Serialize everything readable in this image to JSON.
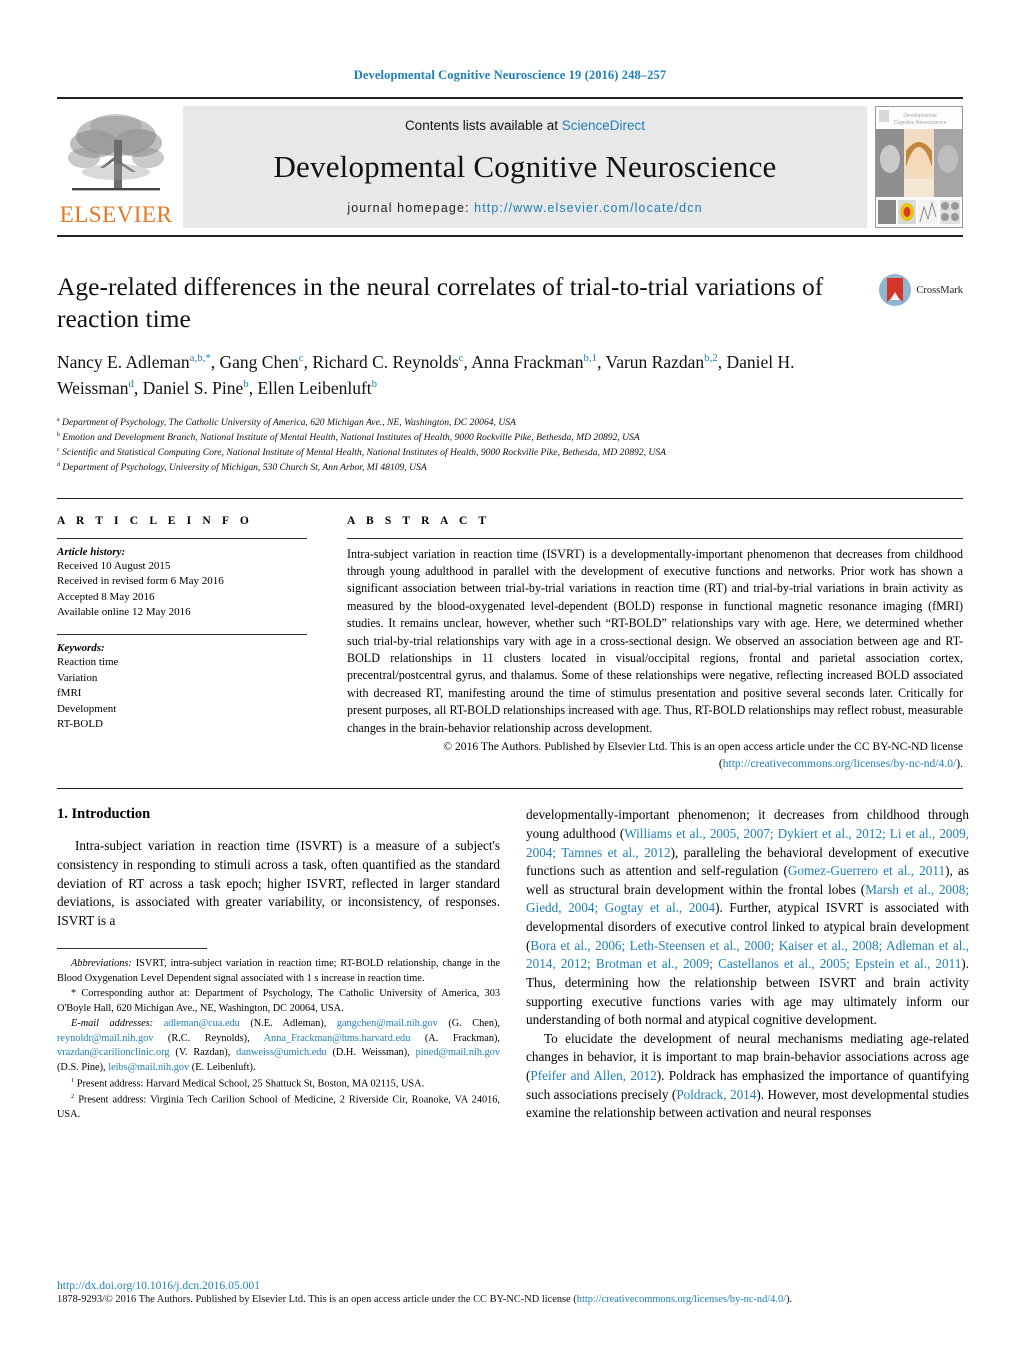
{
  "running_head": "Developmental Cognitive Neuroscience 19 (2016) 248–257",
  "banner": {
    "contents_prefix": "Contents lists available at ",
    "contents_link": "ScienceDirect",
    "journal_name": "Developmental Cognitive Neuroscience",
    "homepage_prefix": "journal homepage: ",
    "homepage_url": "http://www.elsevier.com/locate/dcn",
    "publisher_word": "ELSEVIER",
    "cover_title_line1": "Developmental",
    "cover_title_line2": "Cognitive Neuroscience"
  },
  "title": "Age-related differences in the neural correlates of trial-to-trial variations of reaction time",
  "crossmark_label": "CrossMark",
  "authors_html": "Nancy E. Adleman<sup>a,b,</sup><sup>*</sup>, Gang Chen<sup>c</sup>, Richard C. Reynolds<sup>c</sup>, Anna Frackman<sup>b,1</sup>, Varun Razdan<sup>b,2</sup>, Daniel H. Weissman<sup>d</sup>, Daniel S. Pine<sup>b</sup>, Ellen Leibenluft<sup>b</sup>",
  "affiliations": [
    {
      "marker": "a",
      "text": "Department of Psychology, The Catholic University of America, 620 Michigan Ave., NE, Washington, DC 20064, USA"
    },
    {
      "marker": "b",
      "text": "Emotion and Development Branch, National Institute of Mental Health, National Institutes of Health, 9000 Rockville Pike, Bethesda, MD 20892, USA"
    },
    {
      "marker": "c",
      "text": "Scientific and Statistical Computing Core, National Institute of Mental Health, National Institutes of Health, 9000 Rockville Pike, Bethesda, MD 20892, USA"
    },
    {
      "marker": "d",
      "text": "Department of Psychology, University of Michigan, 530 Church St, Ann Arbor, MI 48109, USA"
    }
  ],
  "article_info": {
    "heading": "A R T I C L E   I N F O",
    "history_label": "Article history:",
    "history": [
      "Received 10 August 2015",
      "Received in revised form 6 May 2016",
      "Accepted 8 May 2016",
      "Available online 12 May 2016"
    ],
    "keywords_label": "Keywords:",
    "keywords": [
      "Reaction time",
      "Variation",
      "fMRI",
      "Development",
      "RT-BOLD"
    ]
  },
  "abstract": {
    "heading": "A B S T R A C T",
    "body": "Intra-subject variation in reaction time (ISVRT) is a developmentally-important phenomenon that decreases from childhood through young adulthood in parallel with the development of executive functions and networks. Prior work has shown a significant association between trial-by-trial variations in reaction time (RT) and trial-by-trial variations in brain activity as measured by the blood-oxygenated level-dependent (BOLD) response in functional magnetic resonance imaging (fMRI) studies. It remains unclear, however, whether such “RT-BOLD” relationships vary with age. Here, we determined whether such trial-by-trial relationships vary with age in a cross-sectional design. We observed an association between age and RT-BOLD relationships in 11 clusters located in visual/occipital regions, frontal and parietal association cortex, precentral/postcentral gyrus, and thalamus. Some of these relationships were negative, reflecting increased BOLD associated with decreased RT, manifesting around the time of stimulus presentation and positive several seconds later. Critically for present purposes, all RT-BOLD relationships increased with age. Thus, RT-BOLD relationships may reflect robust, measurable changes in the brain-behavior relationship across development.",
    "copyright_text": "© 2016 The Authors. Published by Elsevier Ltd. This is an open access article under the CC BY-NC-ND license (",
    "copyright_link": "http://creativecommons.org/licenses/by-nc-nd/4.0/",
    "copyright_tail": ")."
  },
  "body_left": {
    "section_number_title": "1.  Introduction",
    "paragraph_1": "Intra-subject variation in reaction time (ISVRT) is a measure of a subject's consistency in responding to stimuli across a task, often quantified as the standard deviation of RT across a task epoch; higher ISVRT, reflected in larger standard deviations, is associated with greater variability, or inconsistency, of responses. ISVRT is a",
    "footnotes": {
      "abbrev_label": "Abbreviations:",
      "abbrev_text": " ISVRT, intra-subject variation in reaction time; RT-BOLD relationship, change in the Blood Oxygenation Level Dependent signal associated with 1 s increase in reaction time.",
      "corresponding_marker": "*",
      "corresponding_text": " Corresponding author at: Department of Psychology, The Catholic University of America, 303 O'Boyle Hall, 620 Michigan Ave., NE, Washington, DC 20064, USA.",
      "email_label": "E-mail addresses:",
      "emails": [
        {
          "addr": "adleman@cua.edu",
          "who": " (N.E. Adleman),"
        },
        {
          "addr": "gangchen@mail.nih.gov",
          "who": " (G. Chen),"
        },
        {
          "addr": "reynoldr@mail.nih.gov",
          "who": " (R.C. Reynolds),"
        },
        {
          "addr": "Anna_Frackman@hms.harvard.edu",
          "who": " (A. Frackman),"
        },
        {
          "addr": "vrazdan@carilionclinic.org",
          "who": " (V. Razdan),"
        },
        {
          "addr": "danweiss@umich.edu",
          "who": " (D.H. Weissman),"
        },
        {
          "addr": "pined@mail.nih.gov",
          "who": " (D.S. Pine),"
        },
        {
          "addr": "leibs@mail.nih.gov",
          "who": " (E. Leibenluft)."
        }
      ],
      "present_1_marker": "1",
      "present_1_text": " Present address: Harvard Medical School, 25 Shattuck St, Boston, MA 02115, USA.",
      "present_2_marker": "2",
      "present_2_text": " Present address: Virginia Tech Carilion School of Medicine, 2 Riverside Cir, Roanoke, VA 24016, USA."
    }
  },
  "body_right": {
    "paragraph_1_html": "developmentally-important phenomenon; it decreases from childhood through young adulthood (<span class=\"lnk\">Williams et al., 2005, 2007; Dykiert et al., 2012; Li et al., 2009, 2004; Tamnes et al., 2012</span>), paralleling the behavioral development of executive functions such as attention and self-regulation (<span class=\"lnk\">Gomez-Guerrero et al., 2011</span>), as well as structural brain development within the frontal lobes (<span class=\"lnk\">Marsh et al., 2008; Giedd, 2004; Gogtay et al., 2004</span>). Further, atypical ISVRT is associated with developmental disorders of executive control linked to atypical brain development (<span class=\"lnk\">Bora et al., 2006; Leth-Steensen et al., 2000; Kaiser et al., 2008; Adleman et al., 2014, 2012; Brotman et al., 2009; Castellanos et al., 2005; Epstein et al., 2011</span>). Thus, determining how the relationship between ISVRT and brain activity supporting executive functions varies with age may ultimately inform our understanding of both normal and atypical cognitive development.",
    "paragraph_2_html": "To elucidate the development of neural mechanisms mediating age-related changes in behavior, it is important to map brain-behavior associations across age (<span class=\"lnk\">Pfeifer and Allen, 2012</span>). Poldrack has emphasized the importance of quantifying such associations precisely (<span class=\"lnk\">Poldrack, 2014</span>). However, most developmental studies examine the relationship between activation and neural responses"
  },
  "footer": {
    "doi": "http://dx.doi.org/10.1016/j.dcn.2016.05.001",
    "copy_prefix": "1878-9293/© 2016 The Authors. Published by Elsevier Ltd. This is an open access article under the CC BY-NC-ND license (",
    "copy_link": "http://creativecommons.org/licenses/by-nc-nd/4.0/",
    "copy_tail": ")."
  },
  "colors": {
    "link": "#1f7fb8",
    "elsevier_orange": "#E87722",
    "banner_gray": "#e8e8e8",
    "crossmark_red": "#d4342a",
    "crossmark_blue": "#8fb6cf"
  }
}
